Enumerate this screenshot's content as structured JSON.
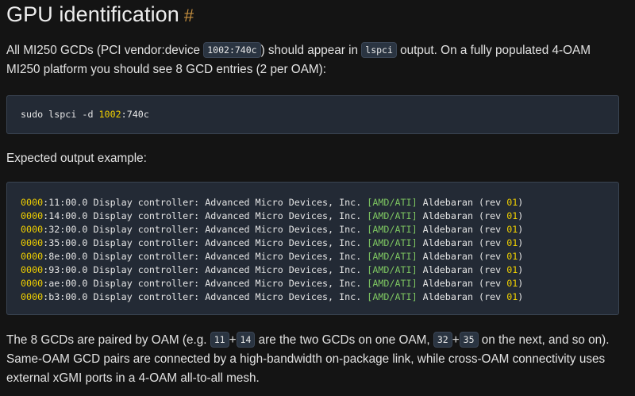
{
  "heading": {
    "title": "GPU identification",
    "anchor": "#"
  },
  "intro": {
    "part1": "All MI250 GCDs (PCI vendor:device ",
    "code1": "1002:740c",
    "part2": ") should appear in ",
    "code2": "lspci",
    "part3": " output. On a fully populated 4-OAM",
    "line2": "MI250 platform you should see 8 GCD entries (2 per OAM):"
  },
  "command": {
    "prefix": "sudo lspci -d ",
    "vendor": "1002",
    "suffix": ":740c"
  },
  "expected_label": "Expected output example:",
  "output_lines": [
    {
      "domain": "0000",
      "bus": ":11:00.0",
      "desc": " Display controller: Advanced Micro Devices, Inc. ",
      "vendor_tag": "[AMD/ATI]",
      "name": " Aldebaran ",
      "rev_open": "(rev ",
      "rev": "01",
      "rev_close": ")"
    },
    {
      "domain": "0000",
      "bus": ":14:00.0",
      "desc": " Display controller: Advanced Micro Devices, Inc. ",
      "vendor_tag": "[AMD/ATI]",
      "name": " Aldebaran ",
      "rev_open": "(rev ",
      "rev": "01",
      "rev_close": ")"
    },
    {
      "domain": "0000",
      "bus": ":32:00.0",
      "desc": " Display controller: Advanced Micro Devices, Inc. ",
      "vendor_tag": "[AMD/ATI]",
      "name": " Aldebaran ",
      "rev_open": "(rev ",
      "rev": "01",
      "rev_close": ")"
    },
    {
      "domain": "0000",
      "bus": ":35:00.0",
      "desc": " Display controller: Advanced Micro Devices, Inc. ",
      "vendor_tag": "[AMD/ATI]",
      "name": " Aldebaran ",
      "rev_open": "(rev ",
      "rev": "01",
      "rev_close": ")"
    },
    {
      "domain": "0000",
      "bus": ":8e:00.0",
      "desc": " Display controller: Advanced Micro Devices, Inc. ",
      "vendor_tag": "[AMD/ATI]",
      "name": " Aldebaran ",
      "rev_open": "(rev ",
      "rev": "01",
      "rev_close": ")"
    },
    {
      "domain": "0000",
      "bus": ":93:00.0",
      "desc": " Display controller: Advanced Micro Devices, Inc. ",
      "vendor_tag": "[AMD/ATI]",
      "name": " Aldebaran ",
      "rev_open": "(rev ",
      "rev": "01",
      "rev_close": ")"
    },
    {
      "domain": "0000",
      "bus": ":ae:00.0",
      "desc": " Display controller: Advanced Micro Devices, Inc. ",
      "vendor_tag": "[AMD/ATI]",
      "name": " Aldebaran ",
      "rev_open": "(rev ",
      "rev": "01",
      "rev_close": ")"
    },
    {
      "domain": "0000",
      "bus": ":b3:00.0",
      "desc": " Display controller: Advanced Micro Devices, Inc. ",
      "vendor_tag": "[AMD/ATI]",
      "name": " Aldebaran ",
      "rev_open": "(rev ",
      "rev": "01",
      "rev_close": ")"
    }
  ],
  "pairing": {
    "p1": "The 8 GCDs are paired by OAM (e.g. ",
    "c1": "11",
    "plus1": "+",
    "c2": "14",
    "p2": " are the two GCDs on one OAM, ",
    "c3": "32",
    "plus2": "+",
    "c4": "35",
    "p3": " on the next, and so on).",
    "line2": "Same-OAM GCD pairs are connected by a high-bandwidth on-package link, while cross-OAM connectivity uses",
    "line3": "external xGMI ports in a 4-OAM all-to-all mesh."
  },
  "colors": {
    "background": "#141414",
    "code_background": "#232a35",
    "number_highlight": "#f0d000",
    "bracket_highlight": "#7cc460",
    "anchor": "#c6903f"
  }
}
